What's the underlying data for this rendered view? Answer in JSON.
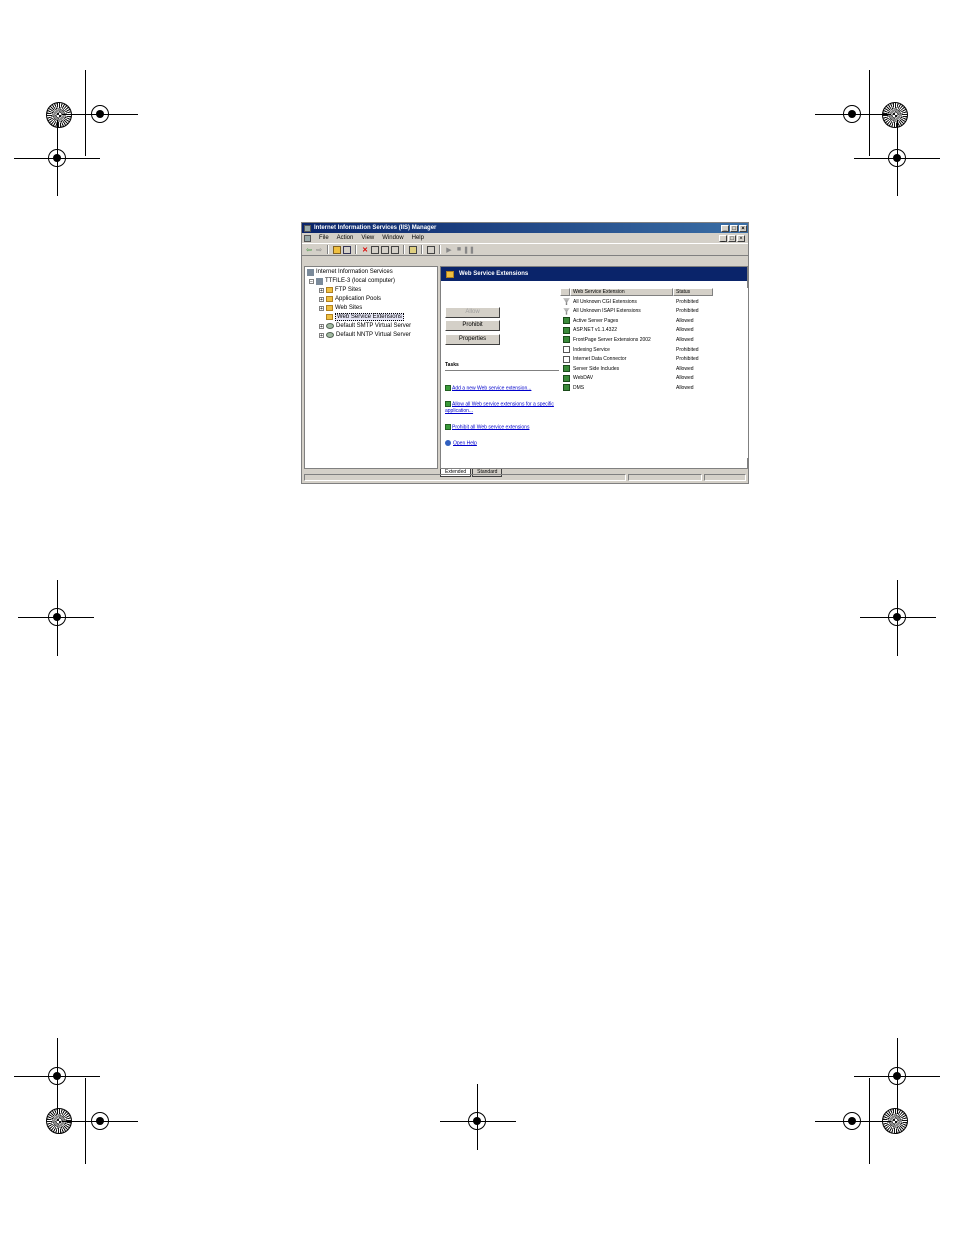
{
  "window": {
    "title": "Internet Information Services (IIS) Manager",
    "controls": {
      "minimize": "_",
      "maximize": "□",
      "close": "×"
    }
  },
  "menu": {
    "items": [
      "File",
      "Action",
      "View",
      "Window",
      "Help"
    ]
  },
  "toolbar": {
    "icons": [
      "back-icon",
      "forward-icon",
      "up-folder-icon",
      "show-hide-tree-icon",
      "delete-icon",
      "properties-icon",
      "refresh-icon",
      "export-icon",
      "help-icon",
      "print-icon",
      "play-icon",
      "stop-icon",
      "pause-icon"
    ]
  },
  "tree": {
    "root": "Internet Information Services",
    "computer": "TTFILE-3 (local computer)",
    "items": [
      "FTP Sites",
      "Application Pools",
      "Web Sites",
      "Web Service Extensions",
      "Default SMTP Virtual Server",
      "Default NNTP Virtual Server"
    ],
    "selected": "Web Service Extensions"
  },
  "panel": {
    "header": "Web Service Extensions",
    "buttons": {
      "allow": "Allow",
      "prohibit": "Prohibit",
      "properties": "Properties"
    },
    "tasks_heading": "Tasks",
    "tasks": [
      "Add a new Web service extension...",
      "Allow all Web service extensions for a specific application...",
      "Prohibit all Web service extensions"
    ],
    "help_link": "Open Help"
  },
  "list": {
    "columns": [
      "Web Service Extension",
      "Status"
    ],
    "rows": [
      {
        "name": "All Unknown CGI Extensions",
        "status": "Prohibited",
        "icon": "filter"
      },
      {
        "name": "All Unknown ISAPI Extensions",
        "status": "Prohibited",
        "icon": "filter"
      },
      {
        "name": "Active Server Pages",
        "status": "Allowed",
        "icon": "web"
      },
      {
        "name": "ASP.NET v1.1.4322",
        "status": "Allowed",
        "icon": "web"
      },
      {
        "name": "FrontPage Server Extensions 2002",
        "status": "Allowed",
        "icon": "web"
      },
      {
        "name": "Indexing Service",
        "status": "Prohibited",
        "icon": "doc"
      },
      {
        "name": "Internet Data Connector",
        "status": "Prohibited",
        "icon": "doc"
      },
      {
        "name": "Server Side Includes",
        "status": "Allowed",
        "icon": "web"
      },
      {
        "name": "WebDAV",
        "status": "Allowed",
        "icon": "web"
      },
      {
        "name": "DMS",
        "status": "Allowed",
        "icon": "web"
      }
    ]
  },
  "tabs": [
    "Extended",
    "Standard"
  ],
  "active_tab": "Extended"
}
